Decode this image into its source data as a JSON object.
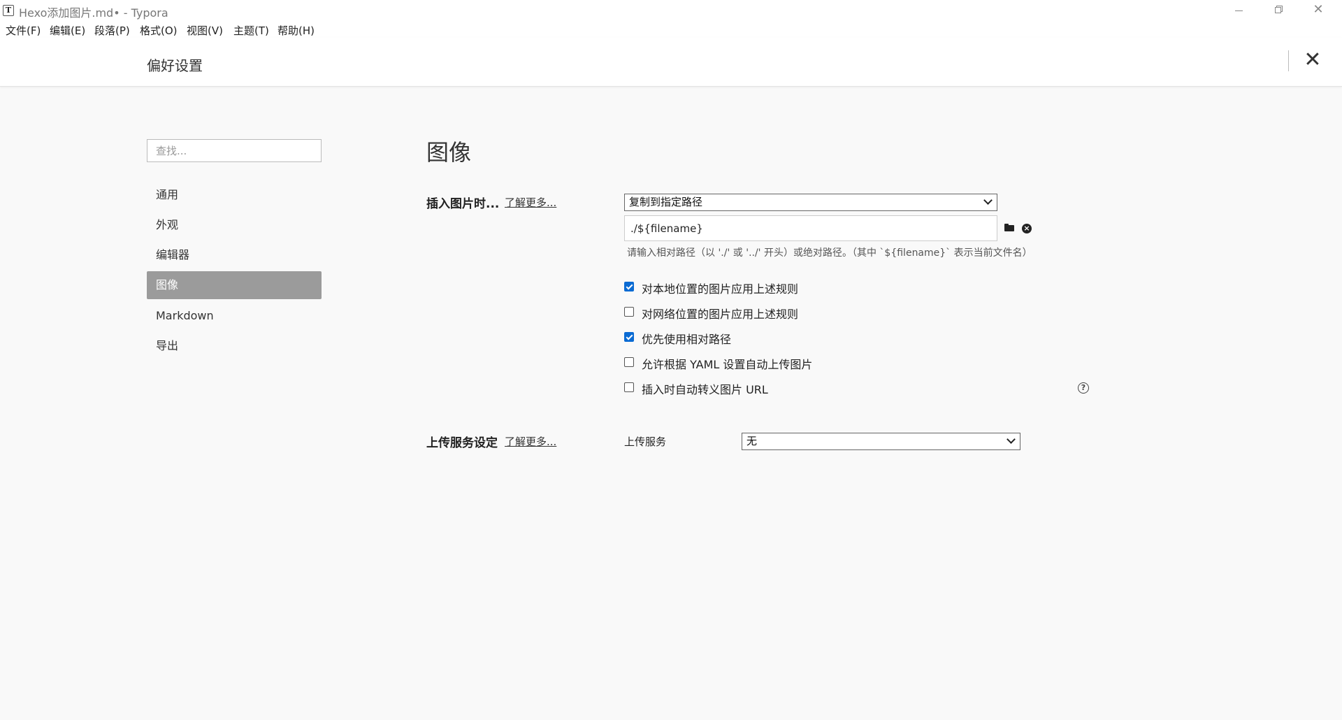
{
  "window": {
    "app_icon": "T",
    "title": "Hexo添加图片.md• - Typora",
    "minimize_icon": "minimize-icon",
    "maximize_icon": "restore-icon",
    "close_glyph": "✕"
  },
  "menu": [
    "文件(F)",
    "编辑(E)",
    "段落(P)",
    "格式(O)",
    "视图(V)",
    "主题(T)",
    "帮助(H)"
  ],
  "header": {
    "title": "偏好设置",
    "close_glyph": "✕"
  },
  "sidebar": {
    "search_placeholder": "查找...",
    "items": [
      {
        "label": "通用",
        "active": false
      },
      {
        "label": "外观",
        "active": false
      },
      {
        "label": "编辑器",
        "active": false
      },
      {
        "label": "图像",
        "active": true
      },
      {
        "label": "Markdown",
        "active": false
      },
      {
        "label": "导出",
        "active": false
      }
    ]
  },
  "main": {
    "section_title": "图像",
    "insert": {
      "label": "插入图片时...",
      "learn_more": "了解更多...",
      "action_select": "复制到指定路径",
      "path_value": "./${filename}",
      "hint": "请输入相对路径（以 './' 或 '../' 开头）或绝对路径。（其中 `${filename}` 表示当前文件名）",
      "folder_icon": "folder-icon",
      "clear_icon": "clear-icon"
    },
    "options": [
      {
        "label": "对本地位置的图片应用上述规则",
        "checked": true
      },
      {
        "label": "对网络位置的图片应用上述规则",
        "checked": false
      },
      {
        "label": "优先使用相对路径",
        "checked": true
      },
      {
        "label": "允许根据 YAML 设置自动上传图片",
        "checked": false
      },
      {
        "label": "插入时自动转义图片 URL",
        "checked": false
      }
    ],
    "help_glyph": "?",
    "upload": {
      "label": "上传服务设定",
      "learn_more": "了解更多...",
      "service_label": "上传服务",
      "service_value": "无"
    }
  },
  "colors": {
    "accent": "#0b6bd3",
    "active_nav_bg": "#9b9b9b",
    "page_bg": "#f9f9f9"
  }
}
